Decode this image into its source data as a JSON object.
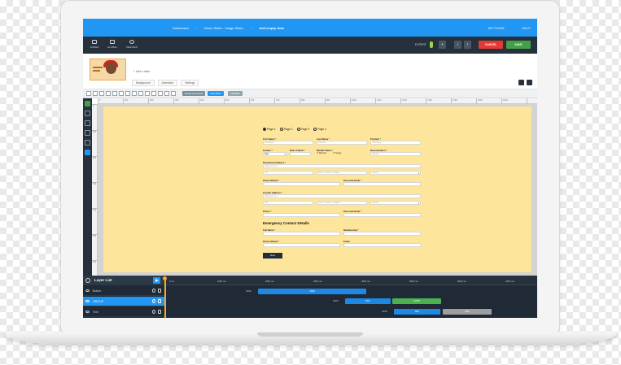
{
  "colors": {
    "topbar": "#2196f3",
    "toolbar": "#26313d",
    "cancel": "#e53935",
    "save": "#43a047",
    "stage": "#fde59b",
    "layer_active": "#2196f3",
    "bar_blue": "#1e88e5",
    "bar_green": "#4caf50",
    "bar_grey": "#9e9e9e"
  },
  "topbar": {
    "crumbs": [
      "Dashboard",
      "Demo Slider - Image Slider",
      "Add empty slide"
    ],
    "right_links": [
      "SETTINGS",
      "HELP"
    ]
  },
  "toolbar": {
    "buttons": [
      {
        "label": "SLIDES",
        "icon": "slides-icon"
      },
      {
        "label": "GLOBAL",
        "icon": "global-icon"
      },
      {
        "label": "PREVIEW",
        "icon": "preview-icon"
      }
    ],
    "expert_label": "EXPERT",
    "cancel_label": "CANCEL",
    "save_label": "SAVE"
  },
  "slidebar": {
    "add_slide": "+ Add a slide",
    "tabs": [
      "Background",
      "Animation",
      "Settings"
    ]
  },
  "canvas_tools": {
    "pills": [
      {
        "label": "Responsive Mode",
        "color": "#78909c"
      },
      {
        "label": "CONTENT",
        "color": "#2196f3"
      },
      {
        "label": "FRAMES",
        "color": "#90a4ae"
      }
    ]
  },
  "ruler": {
    "top": [
      "0",
      "100",
      "200",
      "300",
      "400",
      "500",
      "600",
      "700",
      "800",
      "900",
      "1000",
      "1100",
      "1200",
      "1300",
      "1400",
      "1500",
      "1600"
    ],
    "left": [
      "0",
      "100",
      "200",
      "300",
      "400",
      "500",
      "600"
    ]
  },
  "form": {
    "steps": [
      "Page 1",
      "Page 2",
      "Page 3",
      "Page 4"
    ],
    "first_name": {
      "label": "First Name *",
      "placeholder": "First Name"
    },
    "last_name": {
      "label": "Last Name *",
      "placeholder": "Surname"
    },
    "position": {
      "label": "Position *",
      "placeholder": "Select one"
    },
    "gender": {
      "label": "Gender *",
      "value": "Male"
    },
    "dob": {
      "label": "Date of Birth *",
      "placeholder": ""
    },
    "marital": {
      "label": "Marital Status *",
      "options": [
        "Married",
        "Single"
      ]
    },
    "denomination": {
      "label": "Denomination *",
      "placeholder": "Religion"
    },
    "permanent_address": {
      "label": "Permanent Address *",
      "placeholder": "Address Line 1",
      "city": "City",
      "state": "State / Province / Region",
      "country": "Country"
    },
    "phone_mobile": {
      "label": "Phone Mobile *"
    },
    "personal_email": {
      "label": "Personal Email *"
    },
    "current_address": {
      "label": "Current Address *",
      "placeholder": "Address Line 1",
      "city": "City",
      "state": "State / Province / Region",
      "country": "Country"
    },
    "phone": {
      "label": "Phone *"
    },
    "personal_email2": {
      "label": "Personal Email *"
    },
    "emergency_title": "Emergency Contact Details",
    "full_name": {
      "label": "Full Name *"
    },
    "relationship": {
      "label": "Relationship *"
    },
    "phone_mobile2": {
      "label": "Phone Mobile *"
    },
    "email": {
      "label": "Email"
    },
    "next": "Next"
  },
  "layers": {
    "title": "Layer List",
    "ticks": [
      "0 ms",
      "1000 ms",
      "2000 ms",
      "3000 ms",
      "4000 ms",
      "5000 ms",
      "6000 ms",
      "7000 ms"
    ],
    "rows": [
      {
        "name": "Button",
        "active": false
      },
      {
        "name": "GROUP",
        "active": true
      },
      {
        "name": "Text",
        "active": false
      }
    ],
    "timings": [
      {
        "start": "1600",
        "bars": [
          {
            "label": "1600",
            "color": "#1e88e5"
          }
        ]
      },
      {
        "start": "3100",
        "bars": [
          {
            "label": "800",
            "color": "#1e88e5"
          },
          {
            "label": "LOOP",
            "color": "#4caf50"
          }
        ]
      },
      {
        "start": "4700",
        "bars": [
          {
            "label": "800",
            "color": "#1e88e5"
          },
          {
            "label": "800",
            "color": "#9e9e9e"
          }
        ]
      }
    ]
  }
}
